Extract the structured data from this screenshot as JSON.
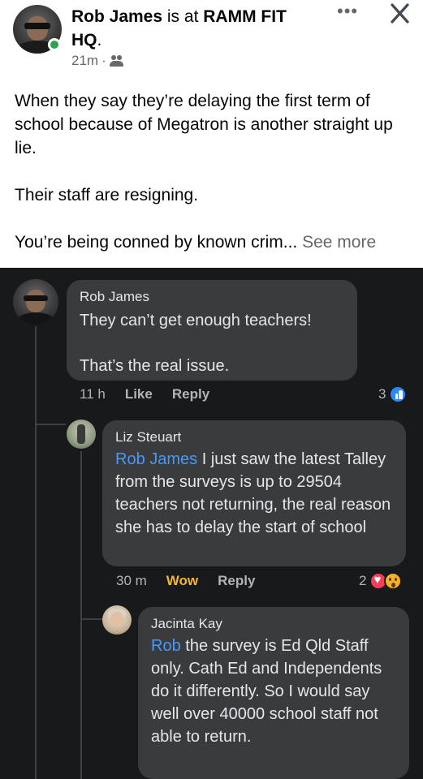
{
  "post": {
    "author": "Rob James",
    "is_at": "is at",
    "place": "RAMM FIT HQ",
    "place_suffix": ".",
    "time": "21m",
    "separator": "·",
    "audience_icon": "friends-icon",
    "more_icon": "more-icon",
    "close_icon": "close-icon",
    "body": [
      "When they say they’re delaying the first term of school because of Megatron is another straight up lie.",
      "Their staff are resigning.",
      "You’re being conned by known crim..."
    ],
    "see_more": "See more"
  },
  "comments": [
    {
      "author": "Rob James",
      "lines": [
        "They can’t get enough teachers!",
        "That’s the real issue."
      ],
      "time": "11 h",
      "like_label": "Like",
      "reply_label": "Reply",
      "reaction_count": "3",
      "reaction_icons": [
        "like-icon"
      ]
    },
    {
      "author": "Liz Steuart",
      "mention": "Rob James",
      "text": "I just saw the latest Talley from the surveys is up to 29504 teachers not returning, the real reason she has to delay the start of school",
      "time": "30 m",
      "like_label": "Wow",
      "reply_label": "Reply",
      "reaction_count": "2",
      "reaction_icons": [
        "love-icon",
        "wow-icon"
      ]
    },
    {
      "author": "Jacinta Kay",
      "mention": "Rob",
      "text": "the survey is Ed Qld Staff only. Cath Ed and Independents do it differently. So I would say well over 40000 school staff not able to return."
    }
  ],
  "colors": {
    "mention": "#4599ff",
    "dark_bg": "#18191a",
    "bubble": "#3a3b3c",
    "wow_action": "#f7b928",
    "online": "#31a24c"
  }
}
